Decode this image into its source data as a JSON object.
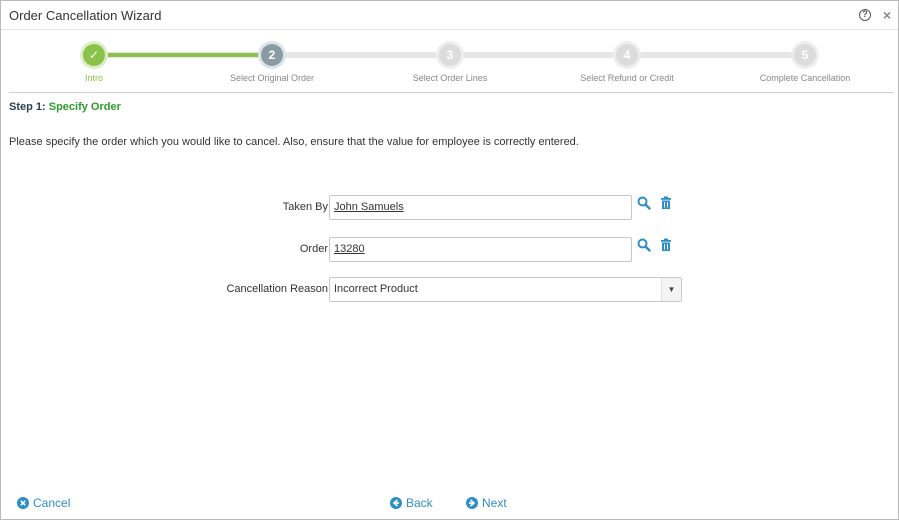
{
  "window": {
    "title": "Order Cancellation Wizard",
    "help_icon": "question-circle-icon",
    "close_icon": "close-icon",
    "help_glyph": "?",
    "close_glyph": "×"
  },
  "steps": [
    {
      "number": "✓",
      "label": "Intro",
      "state": "done"
    },
    {
      "number": "2",
      "label": "Select Original Order",
      "state": "current"
    },
    {
      "number": "3",
      "label": "Select Order Lines",
      "state": "todo"
    },
    {
      "number": "4",
      "label": "Select Refund or Credit",
      "state": "todo"
    },
    {
      "number": "5",
      "label": "Complete Cancellation",
      "state": "todo"
    }
  ],
  "heading": {
    "prefix": "Step 1: ",
    "title": "Specify Order"
  },
  "instructions": "Please specify the order which you would like to cancel. Also, ensure that the value for employee is correctly entered.",
  "form": {
    "taken_by": {
      "label": "Taken By",
      "value": "John Samuels"
    },
    "order": {
      "label": "Order",
      "value": "13280"
    },
    "reason": {
      "label": "Cancellation Reason",
      "value": "Incorrect Product",
      "arrow": "▼"
    }
  },
  "footer": {
    "cancel": "Cancel",
    "back": "Back",
    "next": "Next"
  },
  "colors": {
    "accent": "#2d8fc5",
    "done": "#8bc34a",
    "heading_green": "#2e9b2e"
  }
}
